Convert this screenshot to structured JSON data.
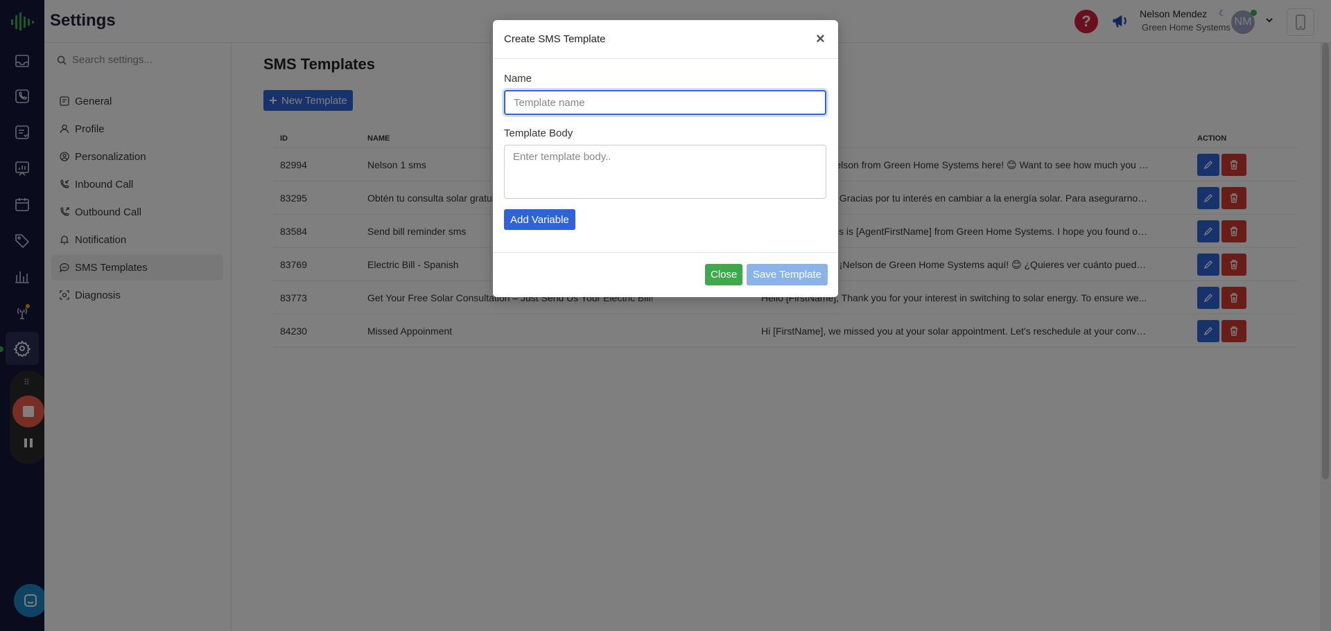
{
  "header": {
    "title": "Settings",
    "help_label": "?",
    "user_name": "Nelson Mendez",
    "user_org": "Green Home Systems",
    "avatar_initials": "NM",
    "moon_glyph": "☾"
  },
  "sidebar": {
    "search_placeholder": "Search settings...",
    "items": [
      {
        "label": "General",
        "icon": "list-icon"
      },
      {
        "label": "Profile",
        "icon": "user-icon"
      },
      {
        "label": "Personalization",
        "icon": "user-circle-icon"
      },
      {
        "label": "Inbound Call",
        "icon": "phone-incoming-icon"
      },
      {
        "label": "Outbound Call",
        "icon": "phone-outgoing-icon"
      },
      {
        "label": "Notification",
        "icon": "bell-icon"
      },
      {
        "label": "SMS Templates",
        "icon": "message-icon"
      },
      {
        "label": "Diagnosis",
        "icon": "diagnosis-icon"
      }
    ],
    "active_item": "SMS Templates"
  },
  "main": {
    "page_title": "SMS Templates",
    "new_button_label": "New Template",
    "columns": {
      "id": "ID",
      "name": "NAME",
      "action": "ACTION"
    },
    "rows": [
      {
        "id": "82994",
        "name": "Nelson 1 sms",
        "body": "Hi [FirstName], Nelson from Green Home Systems here! 😊 Want to see how much you could save..."
      },
      {
        "id": "83295",
        "name": "Obtén tu consulta solar gratuita",
        "body": "Hola [FirstName], Gracias por tu interés en cambiar a la energía solar. Para asegurarnos de..."
      },
      {
        "id": "83584",
        "name": "Send bill reminder sms",
        "body": "Hi [FirstName], this is [AgentFirstName] from Green Home Systems. I hope you found our..."
      },
      {
        "id": "83769",
        "name": "Electric Bill - Spanish",
        "body": "Hola [FirstName], ¡Nelson de Green Home Systems aquí! 😊 ¿Quieres ver cuánto puedes ahorrar..."
      },
      {
        "id": "83773",
        "name": "Get Your Free Solar Consultation – Just Send Us Your Electric Bill!",
        "body": "Hello [FirstName], Thank you for your interest in switching to solar energy. To ensure we..."
      },
      {
        "id": "84230",
        "name": "Missed Appoinment",
        "body": "Hi [FirstName], we missed you at your solar appointment. Let's reschedule at your convenience..."
      }
    ]
  },
  "modal": {
    "title": "Create SMS Template",
    "close_glyph": "×",
    "name_label": "Name",
    "name_placeholder": "Template name",
    "name_value": "",
    "body_label": "Template Body",
    "body_placeholder": "Enter template body..",
    "body_value": "",
    "add_variable_label": "Add Variable",
    "close_label": "Close",
    "save_label": "Save Template"
  },
  "colors": {
    "primary": "#2e64d8",
    "success": "#3ea94a",
    "danger": "#d23b33",
    "rail": "#14193a"
  }
}
